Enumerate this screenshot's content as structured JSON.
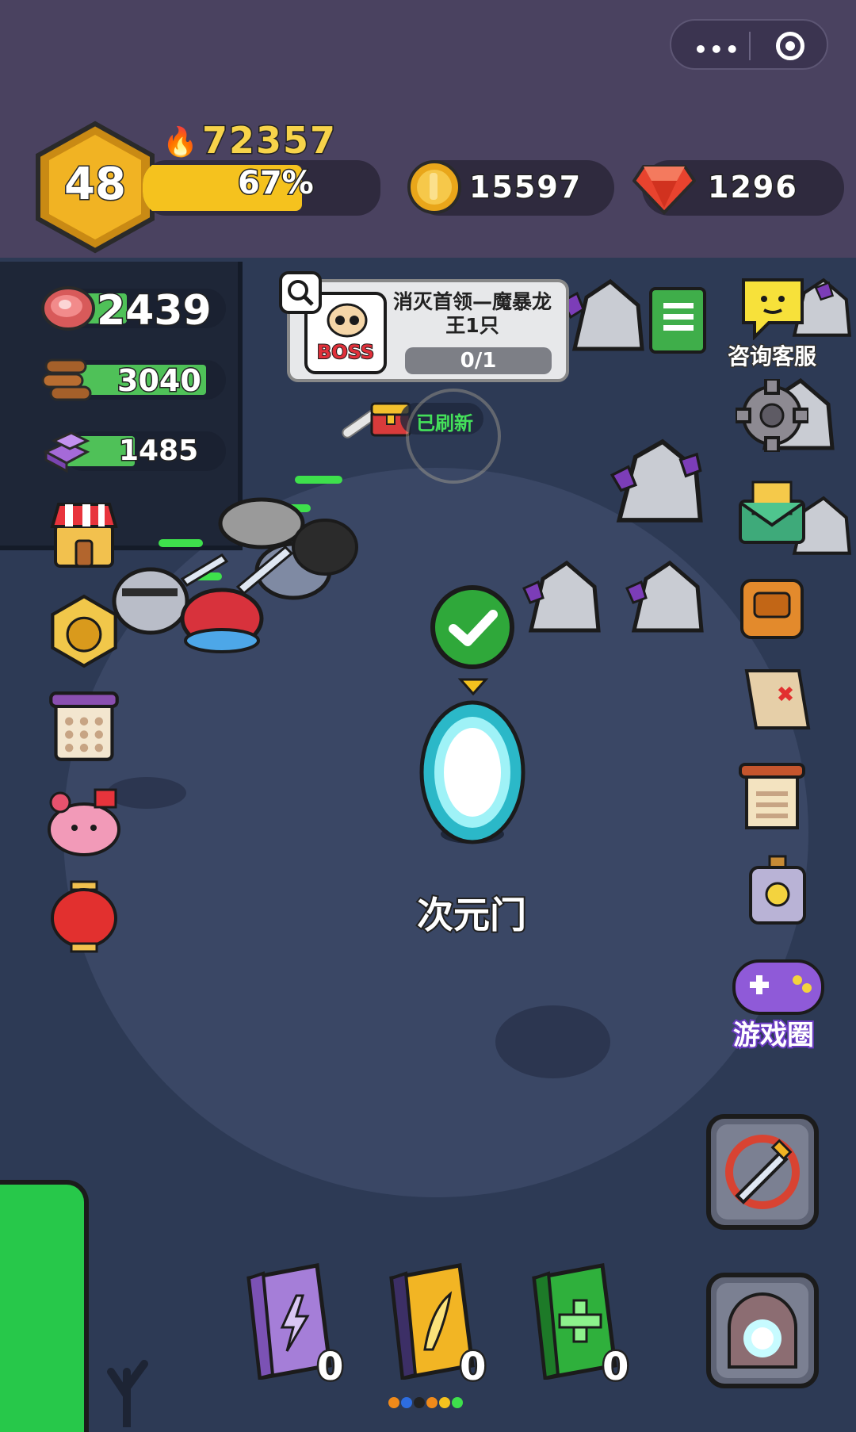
{
  "header": {
    "level": "48",
    "power": "72357",
    "xp_percent": "67%",
    "xp_fraction": 0.67,
    "gold": "15597",
    "gems": "1296"
  },
  "resources": {
    "meat": "2439",
    "wood": "3040",
    "ore": "1485"
  },
  "quest": {
    "title": "消灭首领—魔暴龙王1只",
    "progress": "0/1",
    "boss_badge": "BOSS"
  },
  "chest_status": "已刷新",
  "portal": {
    "label": "次元门"
  },
  "right_menu": {
    "customer_service": "咨询客服",
    "game_circle": "游戏圈"
  },
  "books": [
    {
      "icon": "lightning-book-icon",
      "count": "0"
    },
    {
      "icon": "wing-book-icon",
      "count": "0"
    },
    {
      "icon": "heal-book-icon",
      "count": "0"
    }
  ],
  "colors": {
    "header_bg": "#4a4260",
    "map_bg": "#2d3a55",
    "xp_fill": "#f5c21e",
    "resource_fill": "#4fc158"
  }
}
